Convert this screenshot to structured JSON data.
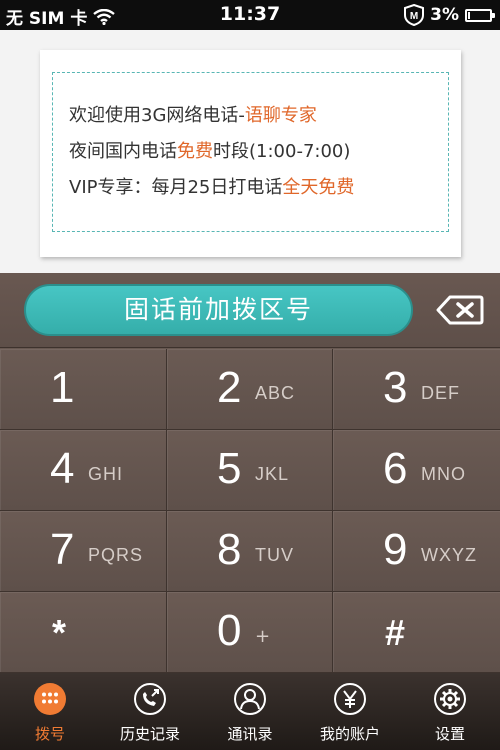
{
  "status_bar": {
    "carrier": "无 SIM 卡",
    "time": "11:37",
    "battery_percent": "3%",
    "battery_level": 0.03,
    "icons": [
      "wifi-icon",
      "shield-icon",
      "battery-icon"
    ]
  },
  "ad": {
    "line1": {
      "prefix": "欢迎使用3G网络电话-",
      "highlight": "语聊专家"
    },
    "line2": {
      "prefix": "夜间国内电话",
      "highlight": "免费",
      "suffix": "时段(1:00-7:00)"
    },
    "line3": {
      "prefix": "VIP专享：每月25日打电话",
      "highlight": "全天免费"
    }
  },
  "dialer": {
    "input_placeholder": "固话前加拨区号",
    "backspace_icon": "backspace-icon",
    "keys": [
      {
        "digit": "1",
        "letters": ""
      },
      {
        "digit": "2",
        "letters": "ABC"
      },
      {
        "digit": "3",
        "letters": "DEF"
      },
      {
        "digit": "4",
        "letters": "GHI"
      },
      {
        "digit": "5",
        "letters": "JKL"
      },
      {
        "digit": "6",
        "letters": "MNO"
      },
      {
        "digit": "7",
        "letters": "PQRS"
      },
      {
        "digit": "8",
        "letters": "TUV"
      },
      {
        "digit": "9",
        "letters": "WXYZ"
      },
      {
        "digit": "*",
        "letters": ""
      },
      {
        "digit": "0",
        "letters": "+"
      },
      {
        "digit": "#",
        "letters": ""
      }
    ]
  },
  "nav": {
    "items": [
      {
        "label": "拨号",
        "icon": "dialpad-icon",
        "active": true
      },
      {
        "label": "历史记录",
        "icon": "call-history-icon",
        "active": false
      },
      {
        "label": "通讯录",
        "icon": "contacts-icon",
        "active": false
      },
      {
        "label": "我的账户",
        "icon": "yen-account-icon",
        "active": false
      },
      {
        "label": "设置",
        "icon": "gear-icon",
        "active": false
      }
    ]
  },
  "colors": {
    "accent_orange": "#f07b33",
    "teal": "#3db9b6",
    "keypad_brown": "#625450",
    "highlight_text": "#e0672a"
  }
}
